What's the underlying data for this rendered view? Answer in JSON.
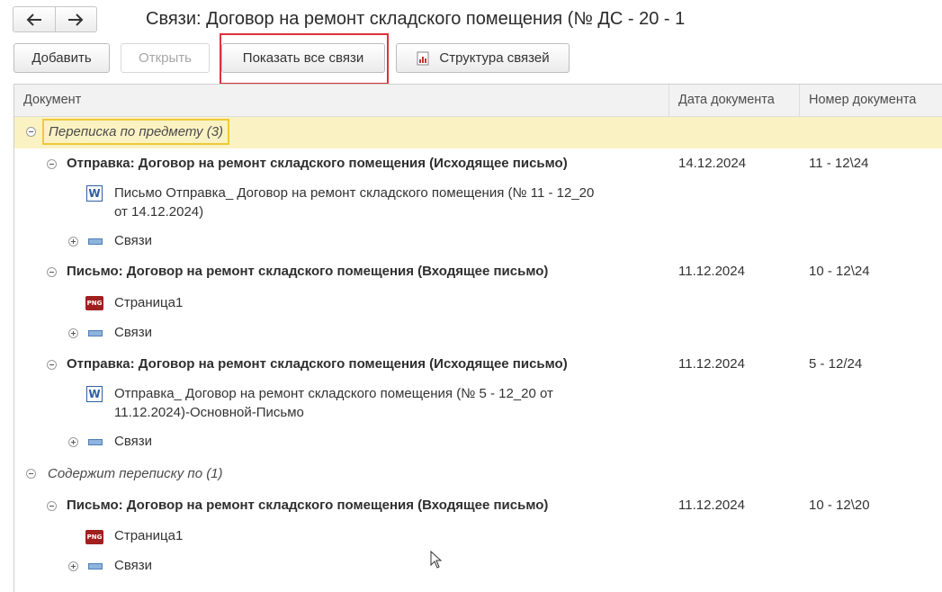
{
  "window": {
    "title": "Связи: Договор на ремонт складского помещения (№ ДС - 20 - 1"
  },
  "nav": {
    "back_icon": "arrow-left-icon",
    "forward_icon": "arrow-right-icon"
  },
  "toolbar": {
    "add_label": "Добавить",
    "open_label": "Открыть",
    "show_all_label": "Показать все связи",
    "structure_label": "Структура связей",
    "structure_icon": "report-structure-icon"
  },
  "table": {
    "columns": [
      "Документ",
      "Дата документа",
      "Номер документа"
    ],
    "group1": {
      "label": "Переписка по предмету (3)",
      "items": [
        {
          "title": "Отправка: Договор на ремонт складского помещения (Исходящее письмо)",
          "date": "14.12.2024",
          "number": "11 - 12\\24",
          "file_line1": "Письмо Отправка_ Договор на ремонт складского помещения (№ 11 - 12_20",
          "file_line2": "от 14.12.2024)",
          "links_label": "Связи"
        },
        {
          "title": "Письмо: Договор на ремонт складского помещения (Входящее письмо)",
          "date": "11.12.2024",
          "number": "10 - 12\\24",
          "file_line1": "Страница1",
          "links_label": "Связи"
        },
        {
          "title": "Отправка: Договор на ремонт складского помещения (Исходящее письмо)",
          "date": "11.12.2024",
          "number": "5 - 12/24",
          "file_line1": "Отправка_ Договор на ремонт складского помещения (№ 5 - 12_20 от",
          "file_line2": "11.12.2024)-Основной-Письмо",
          "links_label": "Связи"
        }
      ]
    },
    "group2": {
      "label": "Содержит переписку по (1)",
      "items": [
        {
          "title": "Письмо: Договор на ремонт складского помещения (Входящее письмо)",
          "date": "11.12.2024",
          "number": "10 - 12\\20",
          "file_line1": "Страница1",
          "links_label": "Связи"
        }
      ]
    },
    "icon_labels": {
      "word": "W",
      "png": "PNG"
    }
  },
  "colors": {
    "accent_highlight": "#d9333b",
    "group_highlight": "#fbf2c3",
    "group_border": "#f0c93a"
  }
}
